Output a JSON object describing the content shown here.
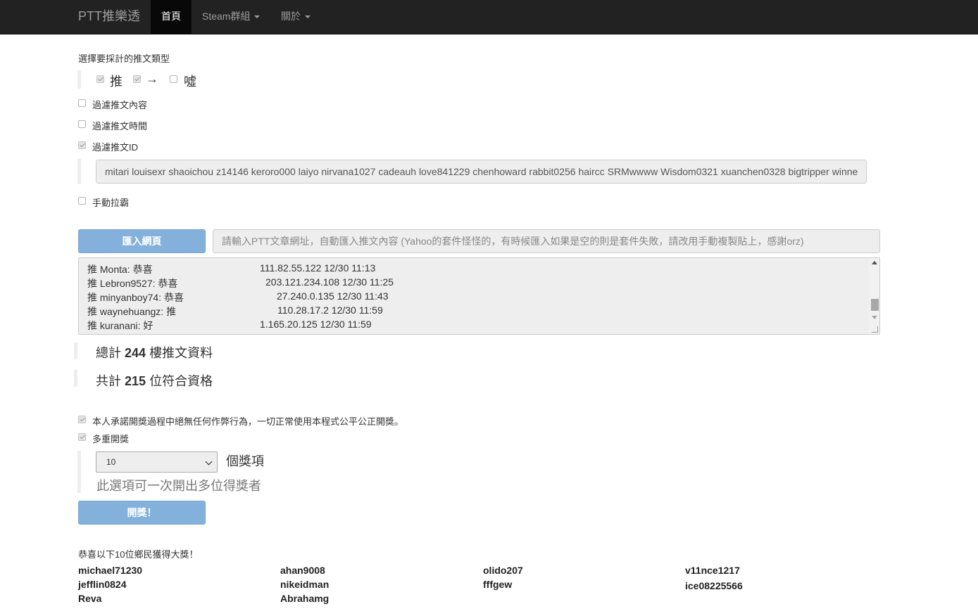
{
  "navbar": {
    "brand": "PTT推樂透",
    "items": [
      {
        "label": "首頁",
        "active": true
      },
      {
        "label": "Steam群組",
        "dropdown": true
      },
      {
        "label": "關於",
        "dropdown": true
      }
    ]
  },
  "push_types": {
    "title": "選擇要採計的推文類型",
    "options": [
      {
        "label": "推",
        "checked": true
      },
      {
        "label": "→",
        "checked": true
      },
      {
        "label": "噓",
        "checked": false
      }
    ]
  },
  "filters": {
    "content": {
      "label": "過濾推文內容",
      "checked": false
    },
    "time": {
      "label": "過濾推文時間",
      "checked": false
    },
    "id": {
      "label": "過濾推文ID",
      "checked": true
    },
    "id_value": "mitari louisexr shaoichou z14146 keroro000 laiyo nirvana1027 cadeauh love841229 chenhoward rabbit0256 haircc SRMwwww Wisdom0321 xuanchen0328 bigtripper winne",
    "manual": {
      "label": "手動拉霸",
      "checked": false
    }
  },
  "import": {
    "button_label": "匯入網頁",
    "placeholder": "請輸入PTT文章網址，自動匯入推文內容 (Yahoo的套件怪怪的，有時候匯入如果是空的則是套件失敗，請改用手動複製貼上，感謝orz)"
  },
  "comments": [
    {
      "text": "推 Monta: 恭喜",
      "meta": "111.82.55.122 12/30 11:13"
    },
    {
      "text": "推 Lebron9527: 恭喜",
      "meta": "203.121.234.108 12/30 11:25"
    },
    {
      "text": "推 minyanboy74: 恭喜",
      "meta": "27.240.0.135 12/30 11:43"
    },
    {
      "text": "推 waynehuangz: 推",
      "meta": "110.28.17.2 12/30 11:59"
    },
    {
      "text": "推 kuranani: 好",
      "meta": "1.165.20.125 12/30 11:59"
    }
  ],
  "stats": {
    "total_prefix": "總計",
    "total_count": "244",
    "total_suffix": "樓推文資料",
    "qualified_prefix": "共計",
    "qualified_count": "215",
    "qualified_suffix": "位符合資格"
  },
  "draw": {
    "pledge": {
      "label": "本人承諾開獎過程中絕無任何作弊行為，一切正常使用本程式公平公正開獎。",
      "checked": true
    },
    "multiple": {
      "label": "多重開獎",
      "checked": true
    },
    "prize_count": "10",
    "prize_unit": "個獎項",
    "help_text": "此選項可一次開出多位得獎者",
    "button_label": "開獎！"
  },
  "results": {
    "title": "恭喜以下10位鄉民獲得大獎！",
    "winners": [
      "michael71230",
      "jefflin0824",
      "Reva",
      "ahan9008",
      "nikeidman",
      "Abrahamg",
      "olido207",
      "fffgew",
      "v11nce1217",
      "ice08225566"
    ]
  },
  "colors": {
    "navbar_bg": "#222222",
    "primary_button": "#83b1dc"
  }
}
